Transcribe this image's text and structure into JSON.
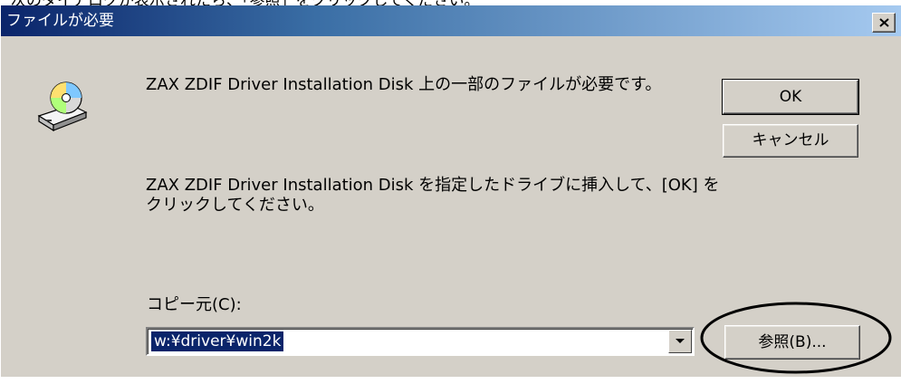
{
  "instruction": "次のダイアログが表示されたら、「参照」をクリックしてください。",
  "dialog": {
    "title": "ファイルが必要",
    "message_1": "ZAX ZDIF Driver Installation Disk 上の一部のファイルが必要です。",
    "message_2": "ZAX ZDIF Driver Installation Disk を指定したドライブに挿入して、[OK] をクリックしてください。",
    "copy_from_label": "コピー元(C):",
    "copy_from_value": "w:¥driver¥win2k",
    "ok_label": "OK",
    "cancel_label": "キャンセル",
    "browse_label": "参照(B)...",
    "icon": "cd-drive-icon"
  },
  "colors": {
    "title_start": "#0a246a",
    "title_end": "#a6caf0",
    "face": "#d4d0c8",
    "selection": "#0a246a"
  }
}
